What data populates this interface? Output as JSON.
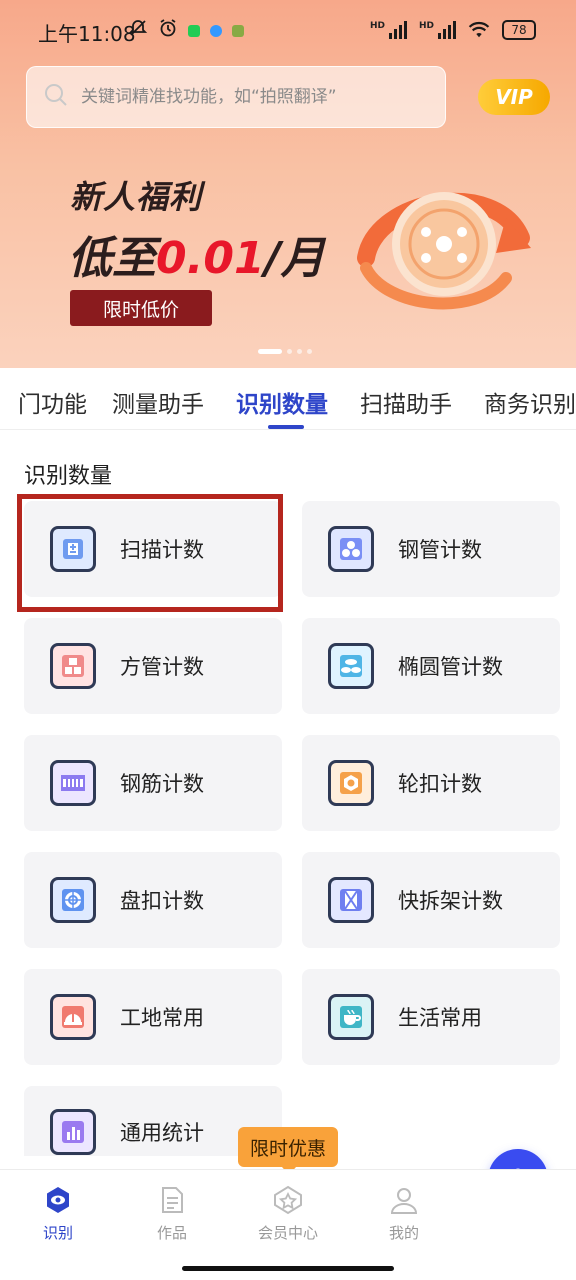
{
  "status_bar": {
    "time": "上午11:08",
    "battery": "78",
    "hd1": "HD",
    "hd2": "HD"
  },
  "search": {
    "placeholder": "关键词精准找功能，如“拍照翻译”"
  },
  "vip_label": "VIP",
  "banner": {
    "line1": "新人福利",
    "line2_prefix": "低至",
    "line2_highlight": "0.01",
    "line2_suffix": "/月",
    "button": "限时低价"
  },
  "tabs": [
    "门功能",
    "测量助手",
    "识别数量",
    "扫描助手",
    "商务识别"
  ],
  "active_tab": "识别数量",
  "section_title": "识别数量",
  "cards": [
    {
      "label": "扫描计数",
      "icon": "scan-count-icon"
    },
    {
      "label": "钢管计数",
      "icon": "steel-pipe-icon"
    },
    {
      "label": "方管计数",
      "icon": "square-pipe-icon"
    },
    {
      "label": "椭圆管计数",
      "icon": "oval-pipe-icon"
    },
    {
      "label": "钢筋计数",
      "icon": "rebar-icon"
    },
    {
      "label": "轮扣计数",
      "icon": "wheel-buckle-icon"
    },
    {
      "label": "盘扣计数",
      "icon": "disc-buckle-icon"
    },
    {
      "label": "快拆架计数",
      "icon": "quick-frame-icon"
    },
    {
      "label": "工地常用",
      "icon": "construction-icon"
    },
    {
      "label": "生活常用",
      "icon": "life-icon"
    },
    {
      "label": "通用统计",
      "icon": "general-stats-icon"
    }
  ],
  "promo_tag": "限时优惠",
  "bottom_nav": [
    {
      "label": "识别",
      "icon": "eye-icon",
      "active": true
    },
    {
      "label": "作品",
      "icon": "document-icon",
      "active": false
    },
    {
      "label": "会员中心",
      "icon": "star-badge-icon",
      "active": false
    },
    {
      "label": "我的",
      "icon": "person-icon",
      "active": false
    }
  ],
  "fab_label": "+",
  "colors": {
    "accent": "#2e45c9",
    "highlight_border": "#b5261e",
    "promo_red": "#e8172a",
    "fab": "#3a4cf0"
  }
}
